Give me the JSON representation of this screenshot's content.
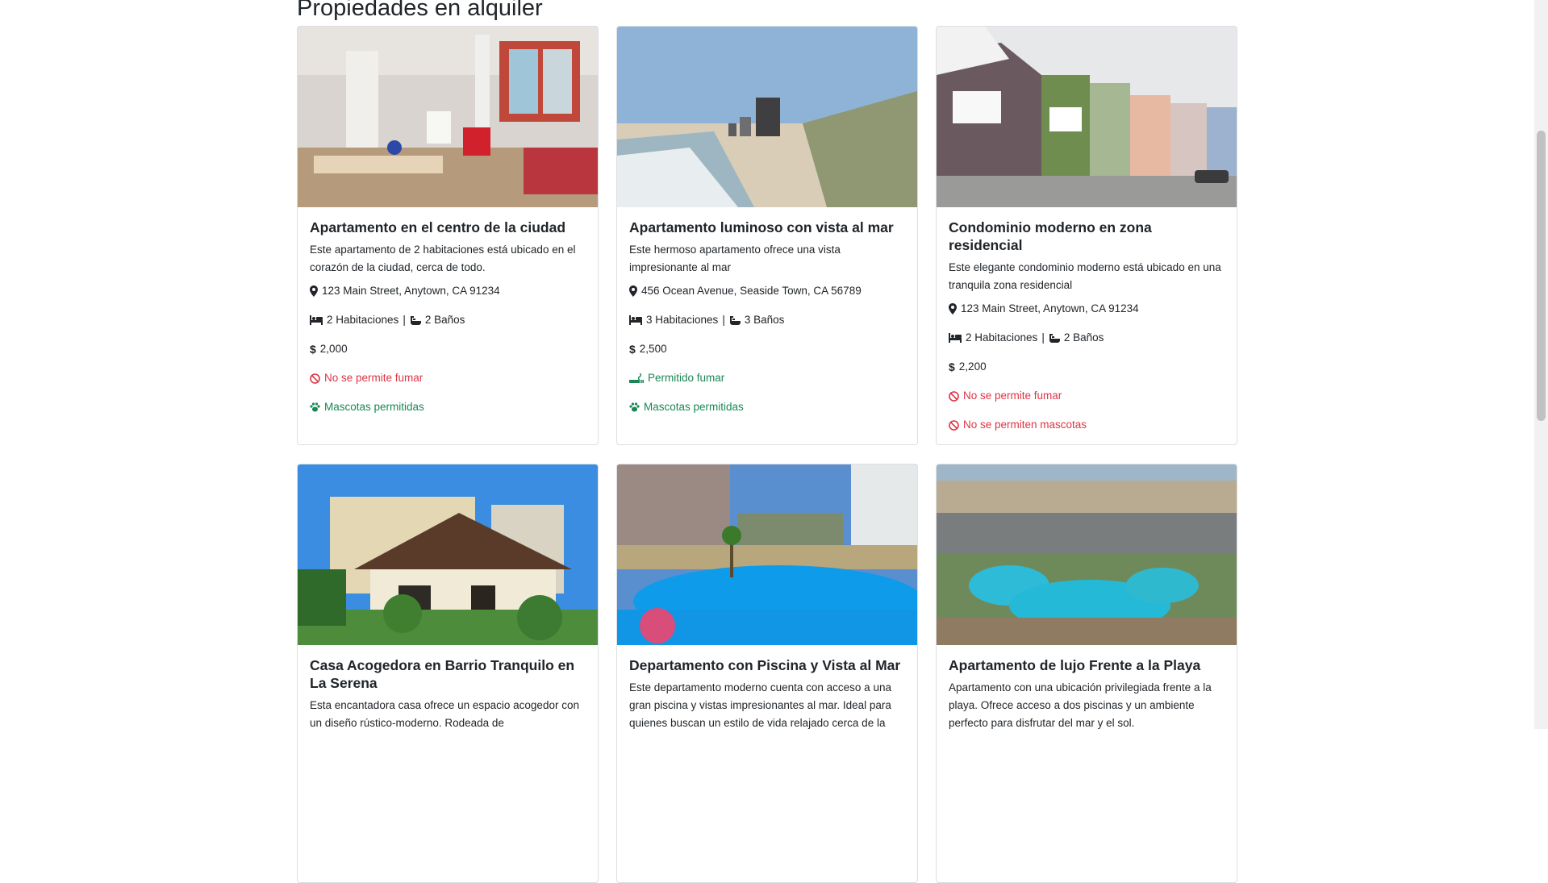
{
  "page": {
    "title": "Propiedades en alquiler"
  },
  "cards": [
    {
      "title": "Apartamento en el centro de la ciudad",
      "description": "Este apartamento de 2 habitaciones está ubicado en el corazón de la ciudad, cerca de todo.",
      "address": "123 Main Street, Anytown, CA 91234",
      "rooms": "2 Habitaciones",
      "baths": "2 Baños",
      "separator": "|",
      "price": "2,000",
      "smoking": "No se permite fumar",
      "pets": "Mascotas permitidas"
    },
    {
      "title": "Apartamento luminoso con vista al mar",
      "description": "Este hermoso apartamento ofrece una vista impresionante al mar",
      "address": "456 Ocean Avenue, Seaside Town, CA 56789",
      "rooms": "3 Habitaciones",
      "baths": "3 Baños",
      "separator": "|",
      "price": "2,500",
      "smoking": "Permitido fumar",
      "pets": "Mascotas permitidas"
    },
    {
      "title": "Condominio moderno en zona residencial",
      "description": "Este elegante condominio moderno está ubicado en una tranquila zona residencial",
      "address": "123 Main Street, Anytown, CA 91234",
      "rooms": "2 Habitaciones",
      "baths": "2 Baños",
      "separator": "|",
      "price": "2,200",
      "smoking": "No se permite fumar",
      "pets": "No se permiten mascotas"
    },
    {
      "title": "Casa Acogedora en Barrio Tranquilo en La Serena",
      "description": "Esta encantadora casa ofrece un espacio acogedor con un diseño rústico-moderno. Rodeada de"
    },
    {
      "title": "Departamento con Piscina y Vista al Mar",
      "description": "Este departamento moderno cuenta con acceso a una gran piscina y vistas impresionantes al mar. Ideal para quienes buscan un estilo de vida relajado cerca de la"
    },
    {
      "title": "Apartamento de lujo Frente a la Playa",
      "description": "Apartamento con una ubicación privilegiada frente a la playa. Ofrece acceso a dos piscinas y un ambiente perfecto para disfrutar del mar y el sol."
    }
  ],
  "icons": {
    "location": "map-marker-icon",
    "bed": "bed-icon",
    "bath": "bath-icon",
    "price": "dollar-icon",
    "no_smoking": "ban-icon",
    "smoking": "smoking-icon",
    "pets": "paw-icon",
    "no_pets": "ban-icon"
  },
  "colors": {
    "danger": "#dc3545",
    "success": "#198754",
    "text": "#212529"
  }
}
